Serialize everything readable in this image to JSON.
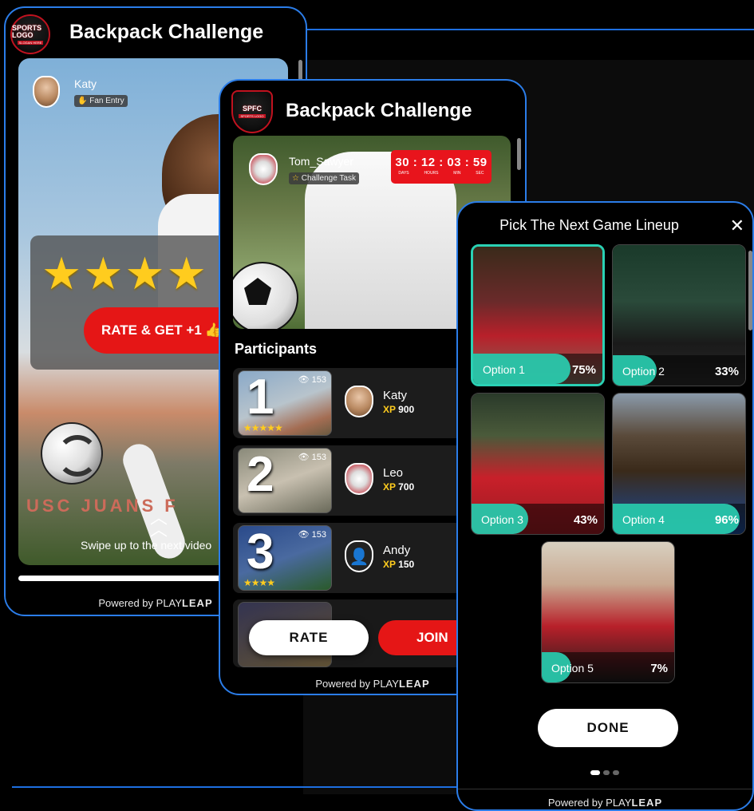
{
  "phone1": {
    "logo_text": "SPORTS LOGO",
    "logo_sub": "SLOGAN HERE",
    "title": "Backpack Challenge",
    "user_name": "Katy",
    "entry_tag": "Fan Entry",
    "stars": "★★★★",
    "rate_button": "RATE & GET +1",
    "swipe_text": "Swipe up to the next video",
    "bg_text": "USC  JUANS  F",
    "powered_prefix": "Powered by PLAY",
    "powered_brand": "LEAP"
  },
  "phone2": {
    "logo_text": "SPFC",
    "logo_sub": "SPORTS LOGO",
    "title": "Backpack Challenge",
    "user_name": "Tom_Sawyer",
    "task_tag": "Challenge Task",
    "timer_value": "30 : 12 : 03 : 59",
    "timer_labels": [
      "DAYS",
      "HOURS",
      "MIN",
      "SEC"
    ],
    "participants_title": "Participants",
    "xp_label": "XP",
    "participants": [
      {
        "rank": "1",
        "views": "153",
        "name": "Katy",
        "xp": "900",
        "stars": "★★★★★"
      },
      {
        "rank": "2",
        "views": "153",
        "name": "Leo",
        "xp": "700",
        "stars": ""
      },
      {
        "rank": "3",
        "views": "153",
        "name": "Andy",
        "xp": "150",
        "stars": "★★★★"
      }
    ],
    "rate_button": "RATE",
    "join_button": "JOIN",
    "powered_prefix": "Powered by PLAY",
    "powered_brand": "LEAP"
  },
  "phone3": {
    "title": "Pick The Next Game Lineup",
    "close_symbol": "✕",
    "options": [
      {
        "label": "Option 1",
        "percent": "75%",
        "value": 75,
        "selected": true
      },
      {
        "label": "Option 2",
        "percent": "33%",
        "value": 33,
        "selected": false
      },
      {
        "label": "Option 3",
        "percent": "43%",
        "value": 43,
        "selected": false
      },
      {
        "label": "Option 4",
        "percent": "96%",
        "value": 96,
        "selected": false
      },
      {
        "label": "Option 5",
        "percent": "7%",
        "value": 7,
        "selected": false
      }
    ],
    "done_button": "DONE",
    "powered_prefix": "Powered by PLAY",
    "powered_brand": "LEAP"
  },
  "colors": {
    "accent_red": "#e51616",
    "accent_teal": "#2ad1b4",
    "star_yellow": "#ffcc1e",
    "frame_blue": "#2b7de9"
  }
}
